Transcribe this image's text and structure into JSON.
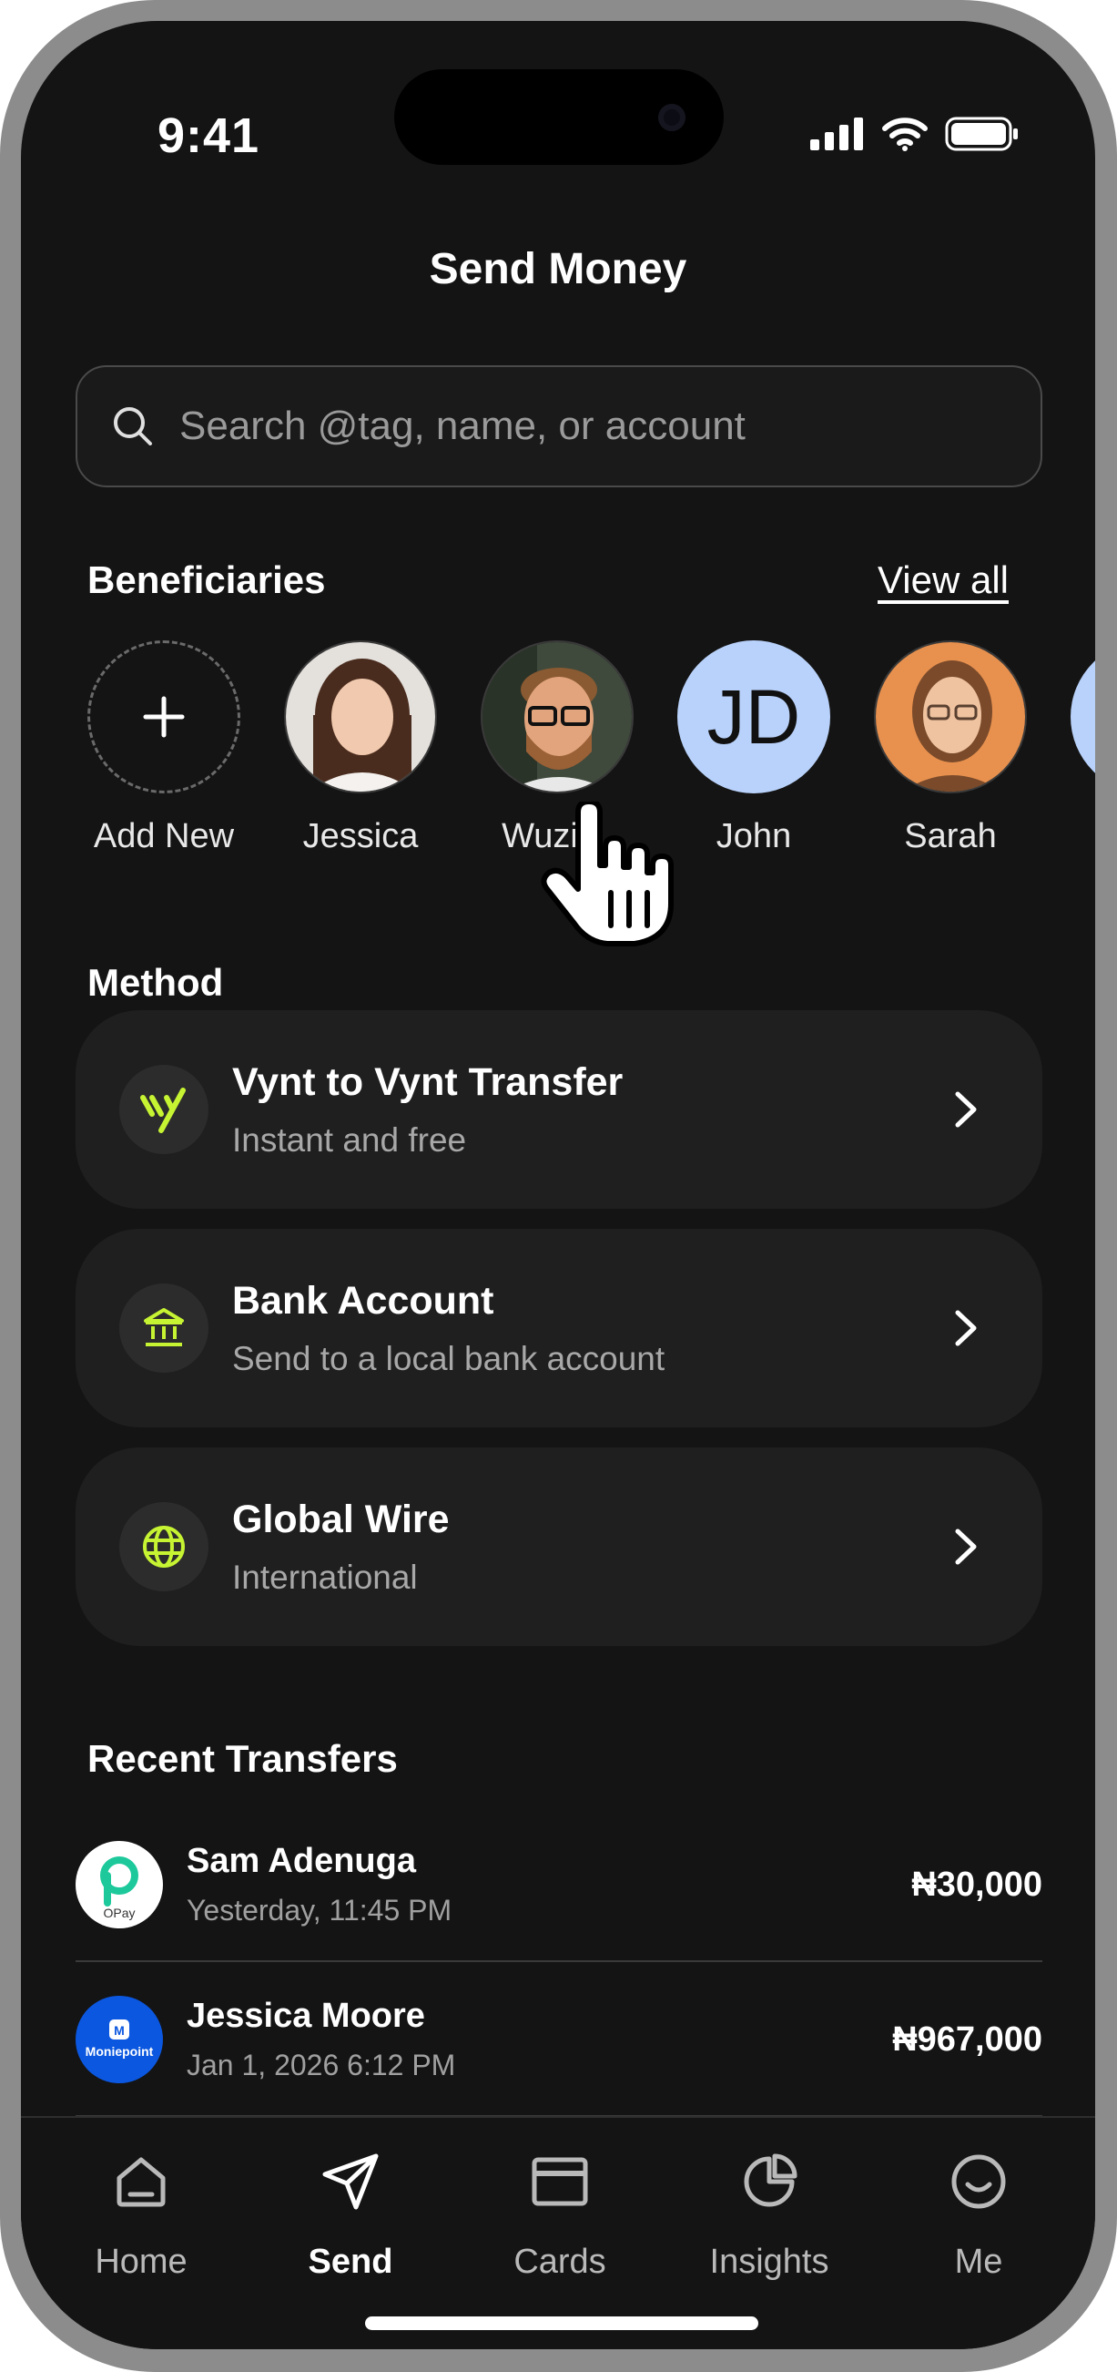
{
  "status": {
    "time": "9:41"
  },
  "header": {
    "title": "Send Money"
  },
  "search": {
    "placeholder": "Search @tag, name, or account"
  },
  "beneficiaries": {
    "heading": "Beneficiaries",
    "view_all": "View all",
    "items": [
      {
        "label": "Add New",
        "icon": "plus-icon"
      },
      {
        "label": "Jessica",
        "avatar": "photo"
      },
      {
        "label": "Wuzi…",
        "avatar": "photo"
      },
      {
        "label": "John",
        "initials": "JD"
      },
      {
        "label": "Sarah",
        "avatar": "photo"
      }
    ]
  },
  "method": {
    "heading": "Method",
    "items": [
      {
        "title": "Vynt to Vynt Transfer",
        "subtitle": "Instant and free",
        "icon": "vynt-logo-icon"
      },
      {
        "title": "Bank Account",
        "subtitle": "Send to a local bank account",
        "icon": "bank-icon"
      },
      {
        "title": "Global Wire",
        "subtitle": "International",
        "icon": "globe-icon"
      }
    ]
  },
  "recent": {
    "heading": "Recent Transfers",
    "items": [
      {
        "name": "Sam Adenuga",
        "date": "Yesterday, 11:45 PM",
        "amount": "₦30,000",
        "logo": "opay-logo",
        "logo_text": "OPay"
      },
      {
        "name": "Jessica Moore",
        "date": "Jan 1, 2026 6:12 PM",
        "amount": "₦967,000",
        "logo": "moniepoint-logo",
        "logo_text": "Moniepoint"
      }
    ]
  },
  "tabs": [
    {
      "label": "Home",
      "icon": "home-icon"
    },
    {
      "label": "Send",
      "icon": "send-icon",
      "active": true
    },
    {
      "label": "Cards",
      "icon": "card-icon"
    },
    {
      "label": "Insights",
      "icon": "pie-chart-icon"
    },
    {
      "label": "Me",
      "icon": "smiley-icon"
    }
  ],
  "colors": {
    "accent": "#c6f432",
    "background": "#141414",
    "card": "#1f1f1f"
  }
}
